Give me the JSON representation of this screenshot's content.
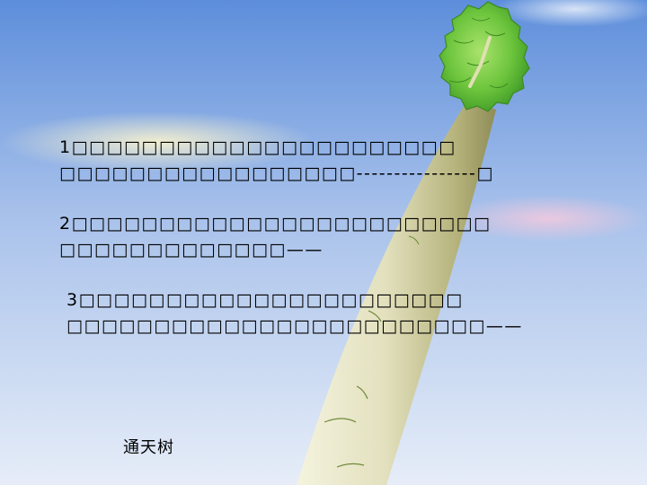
{
  "slide": {
    "q1": {
      "line1": "1□□□□□□□□□□□□□□□□□□□□□□",
      "line2": "□□□□□□□□□□□□□□□□□----------------□"
    },
    "q2": {
      "line1": "2□□□□□□□□□□□□□□□□□□□□□□□□",
      "line2": "□□□□□□□□□□□□□——"
    },
    "q3": {
      "line1": "3□□□□□□□□□□□□□□□□□□□□□□",
      "line2": "□□□□□□□□□□□□□□□□□□□□□□□□——"
    },
    "caption": "通天树"
  },
  "colors": {
    "sky_top": "#5f8fdc",
    "sky_bottom": "#e4ecf7",
    "trunk_light": "#ecebd2",
    "trunk_dark": "#8c8a55",
    "foliage": "#6cc43c"
  }
}
